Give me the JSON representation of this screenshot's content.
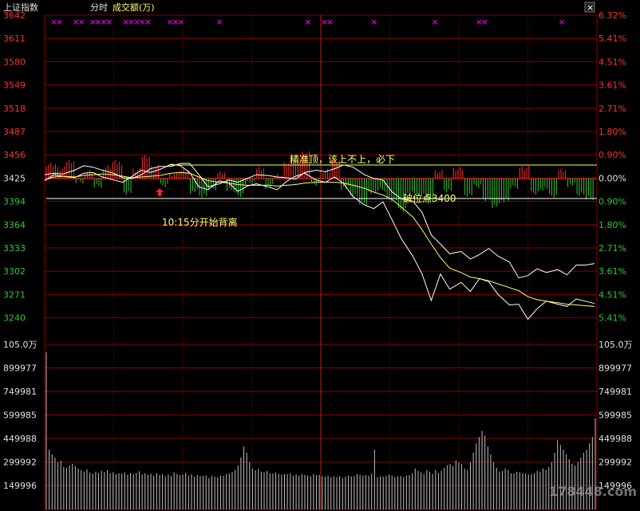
{
  "header": {
    "index_name": "上证指数",
    "mode": "分时",
    "volume_label": "成交额(万)",
    "close_button": "×"
  },
  "colors": {
    "up": "#ff3030",
    "down": "#33c733",
    "grid": "#8b0000",
    "price_line": "#ffffff",
    "avg_line": "#ffff66",
    "volume_bar": "#c0c0c0",
    "annotation": "#ffff66",
    "marker": "#ff00ff"
  },
  "chart_data": [
    {
      "type": "line",
      "name": "intraday-price",
      "y_ticks_left": [
        "3642",
        "3611",
        "3580",
        "3549",
        "3518",
        "3487",
        "3456",
        "3425",
        "3394",
        "3364",
        "3333",
        "3302",
        "3271",
        "3240"
      ],
      "y_ticks_right": [
        "6.32%",
        "5.41%",
        "4.51%",
        "3.61%",
        "2.71%",
        "1.80%",
        "0.90%",
        "0.00%",
        "0.90%",
        "1.80%",
        "2.71%",
        "3.61%",
        "4.51%",
        "5.41%"
      ],
      "ylim": [
        3240,
        3642
      ],
      "baseline": 3425,
      "x": [
        0,
        4,
        8,
        13,
        17,
        21,
        25,
        30,
        34,
        38,
        42,
        46,
        50,
        55,
        59,
        63,
        67,
        71,
        76,
        80,
        84,
        88,
        92,
        97,
        101,
        105,
        109,
        113,
        118,
        122,
        126,
        130,
        134,
        139,
        143,
        147,
        151,
        155,
        160,
        164,
        168,
        172,
        176,
        181,
        185,
        189,
        193,
        197,
        202,
        206,
        210,
        214,
        218,
        223,
        227,
        231,
        235,
        239
      ],
      "series": [
        {
          "values": [
            3422,
            3430,
            3428,
            3426,
            3432,
            3433,
            3427,
            3423,
            3420,
            3428,
            3436,
            3433,
            3437,
            3444,
            3442,
            3433,
            3414,
            3410,
            3422,
            3419,
            3408,
            3415,
            3418,
            3414,
            3410,
            3421,
            3428,
            3432,
            3423,
            3420,
            3427,
            3418,
            3401,
            3390,
            3385,
            3394,
            3370,
            3345,
            3322,
            3298,
            3263,
            3298,
            3278,
            3287,
            3275,
            3292,
            3288,
            3271,
            3257,
            3258,
            3238,
            3252,
            3262,
            3258,
            3255,
            3265,
            3262,
            3259
          ]
        },
        {
          "values": [
            3423,
            3427,
            3428,
            3427,
            3429,
            3430,
            3431,
            3430,
            3428,
            3426,
            3427,
            3428,
            3429,
            3432,
            3433,
            3432,
            3427,
            3422,
            3420,
            3419,
            3417,
            3416,
            3416,
            3416,
            3415,
            3416,
            3417,
            3419,
            3420,
            3420,
            3420,
            3419,
            3416,
            3412,
            3407,
            3403,
            3397,
            3387,
            3374,
            3357,
            3338,
            3320,
            3306,
            3300,
            3294,
            3292,
            3289,
            3285,
            3280,
            3276,
            3268,
            3264,
            3262,
            3260,
            3258,
            3257,
            3256,
            3255
          ]
        },
        {
          "values": [
            3430,
            3432,
            3431,
            3436,
            3442,
            3440,
            3436,
            3432,
            3426,
            3425,
            3430,
            3438,
            3441,
            3441,
            3445,
            3445,
            3430,
            3414,
            3418,
            3423,
            3420,
            3425,
            3430,
            3429,
            3427,
            3426,
            3424,
            3433,
            3436,
            3434,
            3438,
            3443,
            3440,
            3430,
            3425,
            3423,
            3407,
            3398,
            3395,
            3380,
            3350,
            3338,
            3325,
            3328,
            3318,
            3324,
            3332,
            3322,
            3314,
            3293,
            3296,
            3305,
            3300,
            3304,
            3297,
            3310,
            3310,
            3312
          ]
        }
      ],
      "volume_ratio_bars": [
        18,
        12,
        22,
        -4,
        8,
        -10,
        14,
        20,
        -18,
        10,
        28,
        14,
        -8,
        6,
        10,
        -16,
        -22,
        -12,
        8,
        -14,
        -20,
        -6,
        12,
        -10,
        4,
        18,
        26,
        32,
        -6,
        10,
        22,
        -12,
        -22,
        -30,
        -18,
        -14,
        -26,
        -40,
        -18,
        -22,
        -30,
        8,
        -16,
        12,
        -20,
        -10,
        -26,
        -34,
        -28,
        -10,
        14,
        -18,
        -12,
        -22,
        10,
        -8,
        -20,
        -24
      ],
      "annotations": [
        {
          "text": "精准顶，该上不上，必下"
        },
        {
          "text": "破位点3400"
        },
        {
          "text": "10:15分开始背离"
        }
      ]
    },
    {
      "type": "bar",
      "name": "turnover-volume",
      "title": "成交额(万)",
      "y_ticks_left": [
        "105.0万",
        "899977",
        "749981",
        "599985",
        "449988",
        "299992",
        "149996"
      ],
      "y_ticks_right": [
        "105.0万",
        "899977",
        "749981",
        "599985",
        "449988",
        "299992",
        "149996"
      ],
      "ylim": [
        0,
        1050000
      ],
      "values": [
        1000000,
        380000,
        350000,
        330000,
        300000,
        310000,
        270000,
        265000,
        280000,
        290000,
        275000,
        260000,
        250000,
        240000,
        255000,
        235000,
        228000,
        240000,
        232000,
        245000,
        238000,
        250000,
        230000,
        236000,
        225000,
        230000,
        228000,
        235000,
        220000,
        232000,
        225000,
        232000,
        242000,
        222000,
        230000,
        220000,
        226000,
        215000,
        230000,
        218000,
        224000,
        210000,
        222000,
        212000,
        236000,
        226000,
        218000,
        222000,
        232000,
        215000,
        224000,
        210000,
        220000,
        212000,
        214000,
        216000,
        200000,
        212000,
        208000,
        205000,
        215000,
        214000,
        225000,
        228000,
        238000,
        250000,
        280000,
        330000,
        400000,
        360000,
        300000,
        260000,
        250000,
        258000,
        240000,
        235000,
        245000,
        230000,
        228000,
        235000,
        225000,
        222000,
        226000,
        224000,
        230000,
        215000,
        222000,
        214000,
        225000,
        220000,
        215000,
        210000,
        225000,
        218000,
        220000,
        210000,
        208000,
        214000,
        206000,
        210000,
        205000,
        212000,
        200000,
        208000,
        215000,
        210000,
        212000,
        225000,
        220000,
        215000,
        218000,
        214000,
        226000,
        380000,
        205000,
        210000,
        208000,
        214000,
        220000,
        215000,
        206000,
        210000,
        212000,
        205000,
        215000,
        218000,
        230000,
        260000,
        245000,
        236000,
        225000,
        250000,
        240000,
        226000,
        252000,
        232000,
        246000,
        265000,
        282000,
        290000,
        276000,
        310000,
        298000,
        290000,
        260000,
        250000,
        300000,
        360000,
        420000,
        460000,
        500000,
        470000,
        400000,
        350000,
        300000,
        265000,
        240000,
        245000,
        260000,
        250000,
        230000,
        228000,
        240000,
        236000,
        230000,
        228000,
        222000,
        225000,
        230000,
        246000,
        240000,
        260000,
        252000,
        270000,
        300000,
        360000,
        440000,
        410000,
        380000,
        350000,
        320000,
        290000,
        280000,
        300000,
        330000,
        360000,
        380000,
        420000,
        460000,
        580000
      ]
    }
  ],
  "watermark": "178448.com"
}
